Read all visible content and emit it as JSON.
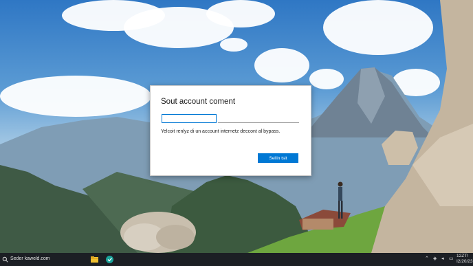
{
  "dialog": {
    "title": "Sout account coment",
    "input_value": "",
    "description": "Yelcoit renlyz di un account internetz deccont al bypass.",
    "button_label": "Sellin tsit"
  },
  "taskbar": {
    "search_text": "Seder kaweld.com",
    "apps": [
      "file-explorer-icon",
      "app-teal-icon"
    ],
    "clock": {
      "time": "12ZT!",
      "date": "I2/20/23"
    }
  },
  "colors": {
    "accent": "#0078d4",
    "taskbar": "#1c1f24",
    "dialog_bg": "#ffffff"
  }
}
